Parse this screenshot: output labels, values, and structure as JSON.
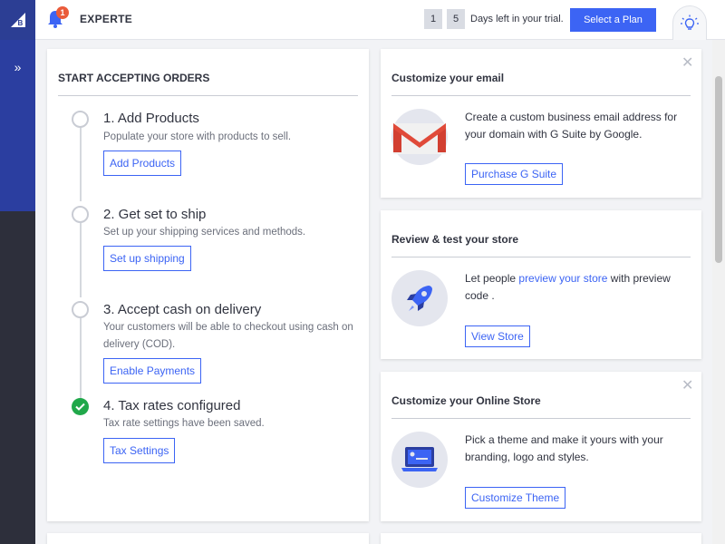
{
  "topbar": {
    "store_name": "EXPERTE",
    "notification_count": "1",
    "trial_digit_1": "1",
    "trial_digit_2": "5",
    "trial_text": "Days left in your trial.",
    "select_plan_label": "Select a Plan"
  },
  "orders_card": {
    "title": "START ACCEPTING ORDERS",
    "steps": [
      {
        "title": "1. Add Products",
        "desc": "Populate your store with products to sell.",
        "button": "Add Products",
        "done": false
      },
      {
        "title": "2. Get set to ship",
        "desc": "Set up your shipping services and methods.",
        "button": "Set up shipping",
        "done": false
      },
      {
        "title": "3. Accept cash on delivery",
        "desc": "Your customers will be able to checkout using cash on delivery (COD).",
        "button": "Enable Payments",
        "done": false
      },
      {
        "title": "4. Tax rates configured",
        "desc": "Tax rate settings have been saved.",
        "button": "Tax Settings",
        "done": true
      }
    ]
  },
  "email_card": {
    "title": "Customize your email",
    "text": "Create a custom business email address for your domain with G Suite by Google.",
    "button": "Purchase G Suite"
  },
  "review_card": {
    "title": "Review & test your store",
    "text_before": "Let people ",
    "link": "preview your store",
    "text_after": " with preview code .",
    "button": "View Store"
  },
  "online_store_card": {
    "title": "Customize your Online Store",
    "text": "Pick a theme and make it yours with your branding, logo and styles.",
    "button": "Customize Theme"
  },
  "colors": {
    "accent": "#3c64f4",
    "rail_blue": "#2b3ea0",
    "success": "#20a84a",
    "badge": "#ea5b3a"
  }
}
